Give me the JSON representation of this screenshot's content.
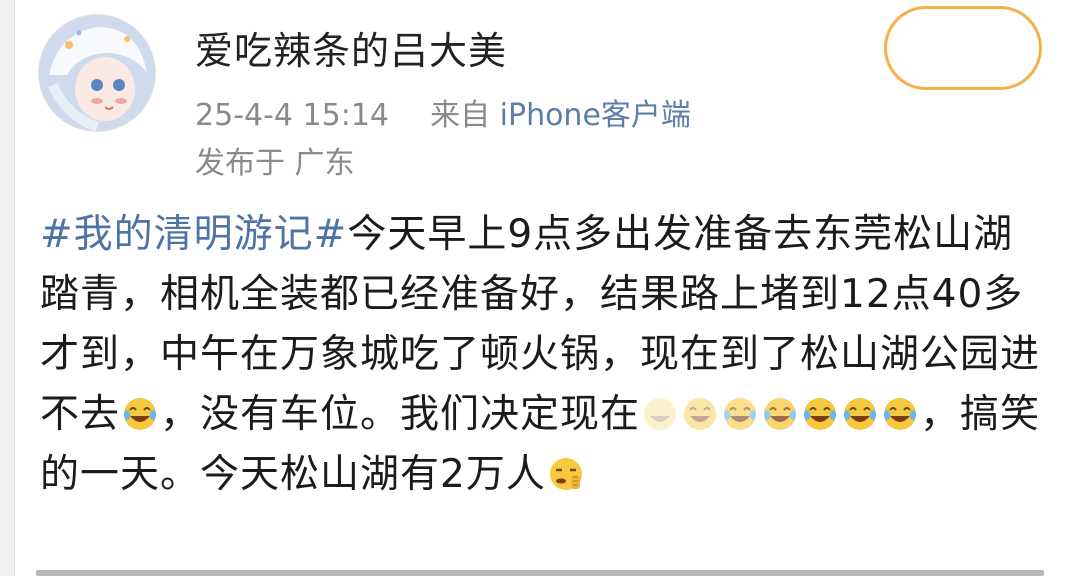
{
  "user": {
    "name": "爱吃辣条的吕大美",
    "avatar_icon": "avatar-image"
  },
  "meta": {
    "datetime": "25-4-4 15:14",
    "from_label": "来自",
    "source": "iPhone客户端",
    "location": "发布于 广东"
  },
  "post": {
    "hashtag": "#我的清明游记#",
    "text_1": "今天早上9点多出发准备去东莞松山湖踏青，相机全装都已经准备好，结果路上堵到12点40多才到，中午在万象城吃了顿火锅，现在到了松山湖公园进不去",
    "text_2": "，没有车位。我们决定现在",
    "text_3": "，搞笑的一天。今天松山湖有2万人"
  },
  "colors": {
    "hashtag": "#4d73a7",
    "meta_gray": "#8a8a8a",
    "follow_border": "#f2b24a"
  },
  "emojis": [
    "tears-of-joy-icon",
    "tears-of-joy-icon",
    "tears-of-joy-icon",
    "tears-of-joy-icon",
    "tears-of-joy-icon",
    "tears-of-joy-icon",
    "tears-of-joy-icon",
    "tears-of-joy-icon",
    "shushing-face-icon"
  ]
}
